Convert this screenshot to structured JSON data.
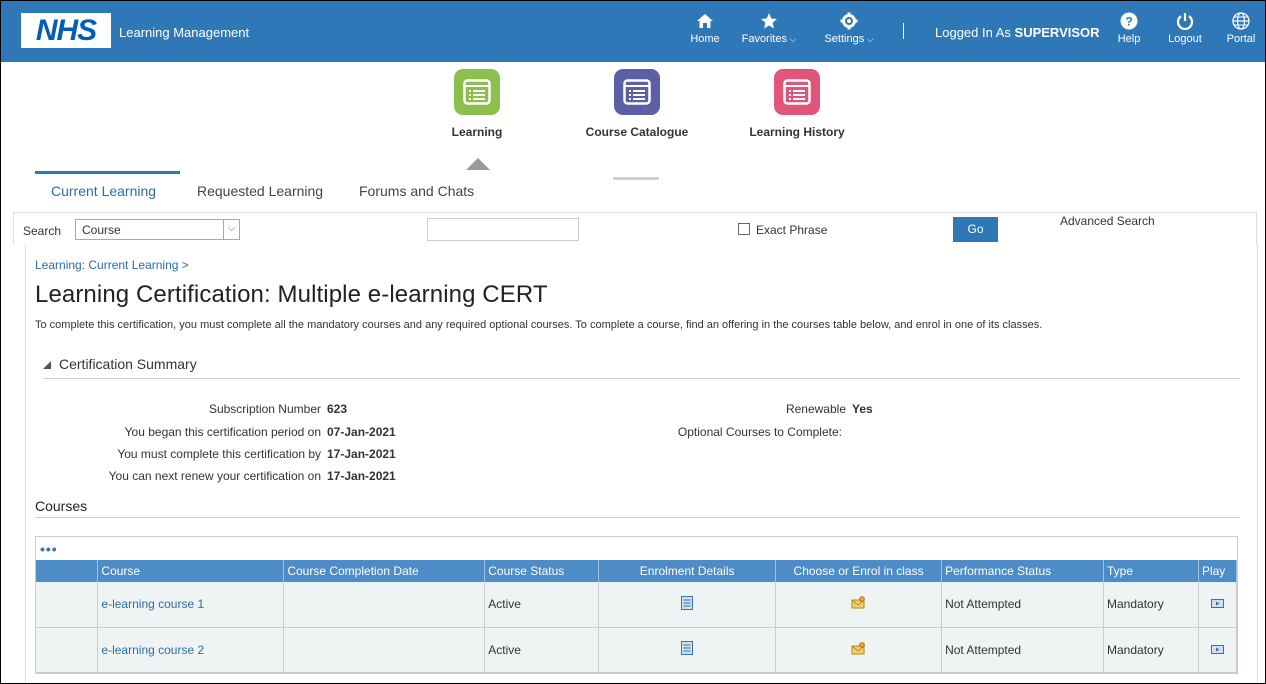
{
  "header": {
    "logo_text": "NHS",
    "app_title": "Learning Management",
    "nav": {
      "home": "Home",
      "favorites": "Favorites",
      "settings": "Settings",
      "help": "Help",
      "logout": "Logout",
      "portal": "Portal"
    },
    "logged_in_prefix": "Logged In As",
    "logged_in_user": "SUPERVISOR"
  },
  "springboard": [
    {
      "label": "Learning",
      "color": "#8cbf4e"
    },
    {
      "label": "Course Catalogue",
      "color": "#5a5fa6"
    },
    {
      "label": "Learning History",
      "color": "#e0567a"
    }
  ],
  "subtabs": {
    "current": "Current Learning",
    "requested": "Requested Learning",
    "forums": "Forums and Chats"
  },
  "search": {
    "label": "Search",
    "selected": "Course",
    "input_value": "",
    "exact_phrase": "Exact Phrase",
    "go": "Go",
    "advanced": "Advanced Search"
  },
  "breadcrumb": "Learning: Current Learning >",
  "page_title": "Learning Certification: Multiple e-learning CERT",
  "instructions": "To complete this certification, you must complete all the mandatory courses and any required optional courses. To complete a course, find an offering in the courses table below, and enrol in one of its classes.",
  "summary": {
    "title": "Certification Summary",
    "subscription_label": "Subscription Number",
    "subscription_value": "623",
    "began_label": "You began this certification period on",
    "began_value": "07-Jan-2021",
    "complete_by_label": "You must complete this certification by",
    "complete_by_value": "17-Jan-2021",
    "renew_label": "You can next renew your certification on",
    "renew_value": "17-Jan-2021",
    "renewable_label": "Renewable",
    "renewable_value": "Yes",
    "optional_label": "Optional Courses to Complete:"
  },
  "courses": {
    "title": "Courses",
    "more": "•••",
    "columns": [
      "Course",
      "Course Completion Date",
      "Course Status",
      "Enrolment Details",
      "Choose or Enrol in class",
      "Performance Status",
      "Type",
      "Play"
    ],
    "rows": [
      {
        "course": "e-learning course 1",
        "completion": "",
        "status": "Active",
        "performance": "Not Attempted",
        "type": "Mandatory"
      },
      {
        "course": "e-learning course 2",
        "completion": "",
        "status": "Active",
        "performance": "Not Attempted",
        "type": "Mandatory"
      }
    ]
  }
}
